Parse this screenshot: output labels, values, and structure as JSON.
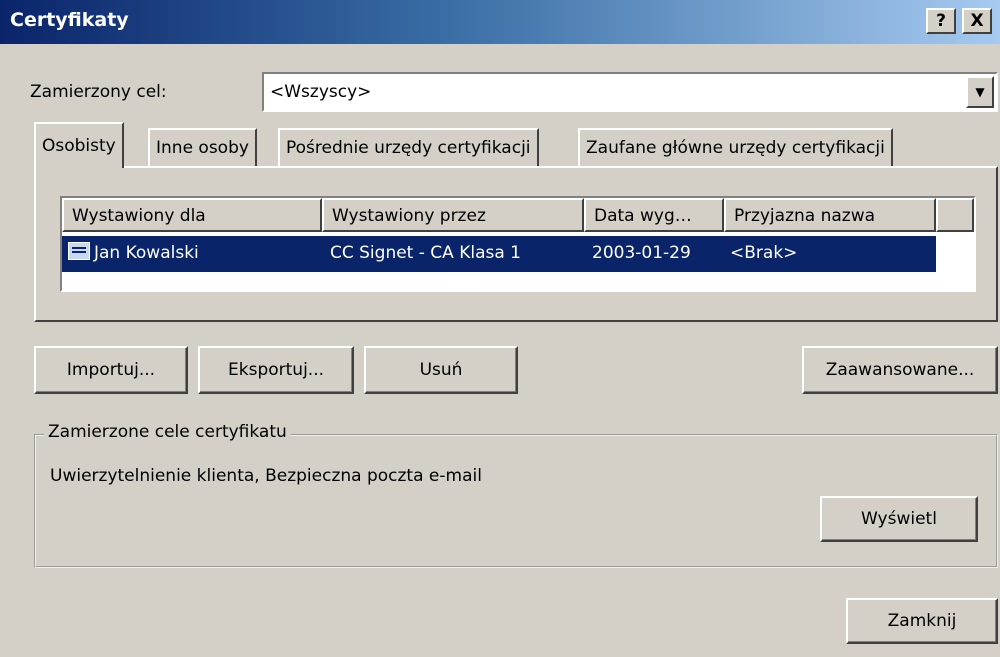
{
  "window": {
    "title": "Certyfikaty",
    "help_label": "?",
    "close_label": "X"
  },
  "purpose": {
    "label": "Zamierzony cel:",
    "value": "<Wszyscy>",
    "arrow_glyph": "▼"
  },
  "tabs": [
    {
      "label": "Osobisty",
      "active": true
    },
    {
      "label": "Inne osoby",
      "active": false
    },
    {
      "label": "Pośrednie urzędy certyfikacji",
      "active": false
    },
    {
      "label": "Zaufane główne urzędy certyfikacji",
      "active": false
    }
  ],
  "table": {
    "columns": [
      "Wystawiony dla",
      "Wystawiony przez",
      "Data wyg…",
      "Przyjazna nazwa"
    ],
    "rows": [
      {
        "issued_to": "Jan Kowalski",
        "issued_by": "CC Signet - CA Klasa 1",
        "expires": "2003-01-29",
        "friendly_name": "<Brak>",
        "selected": true,
        "icon": "certificate-icon"
      }
    ]
  },
  "buttons": {
    "import": "Importuj...",
    "export": "Eksportuj...",
    "remove": "Usuń",
    "advanced": "Zaawansowane...",
    "view": "Wyświetl",
    "close": "Zamknij"
  },
  "cert_purposes": {
    "title": "Zamierzone cele certyfikatu",
    "text": "Uwierzytelnienie klienta, Bezpieczna poczta e-mail"
  },
  "colors": {
    "selection": "#0a246a",
    "face": "#d4d0c8"
  }
}
